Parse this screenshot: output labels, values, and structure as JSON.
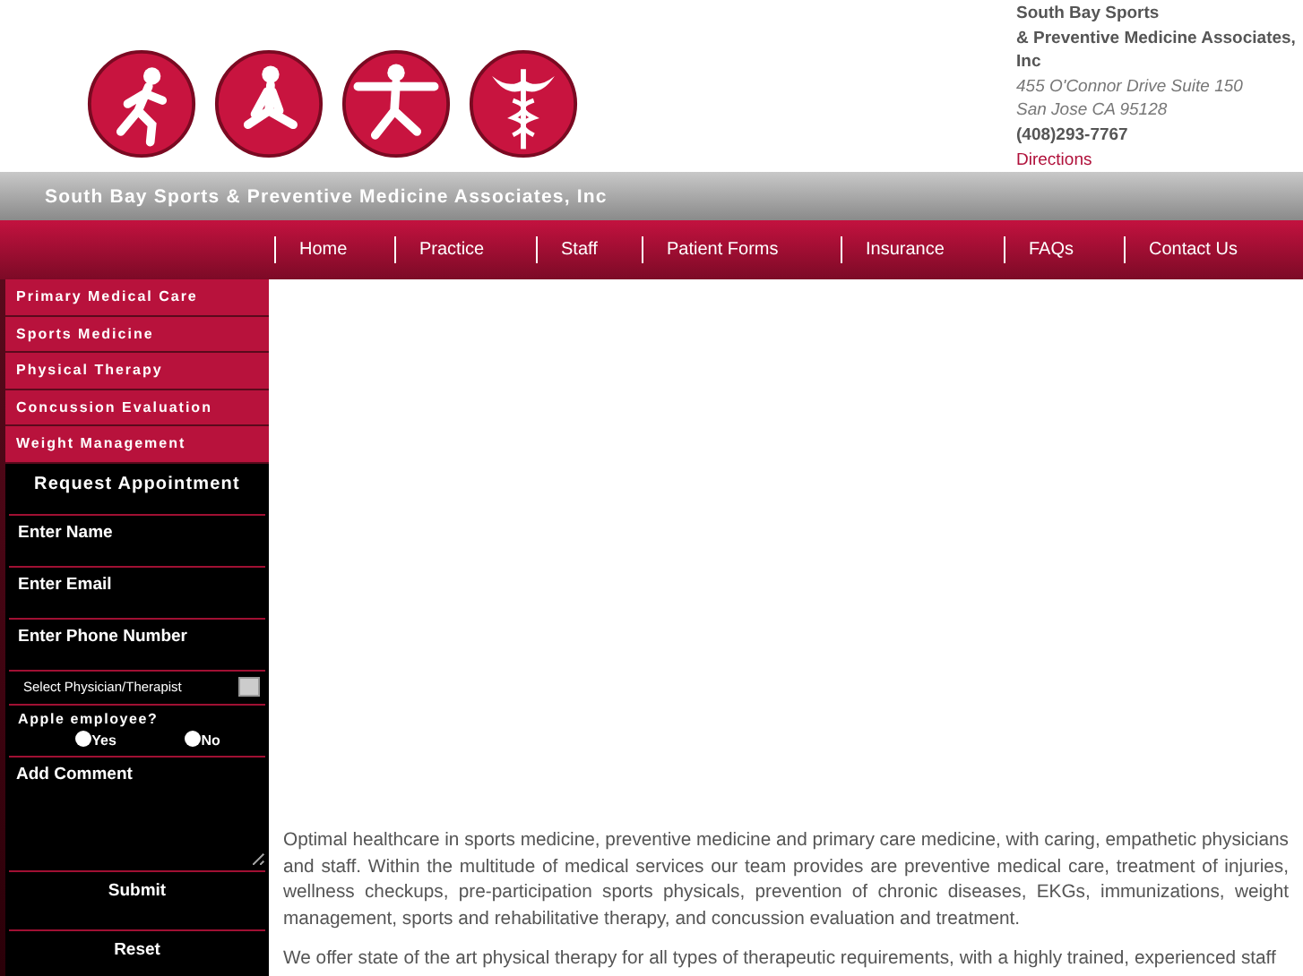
{
  "logo_icons": [
    {
      "kind": "runner"
    },
    {
      "kind": "sitting"
    },
    {
      "kind": "yoga"
    },
    {
      "kind": "caduceus"
    }
  ],
  "contact": {
    "name_lines": [
      "South Bay Sports",
      "& Preventive Medicine Associates,",
      "Inc"
    ],
    "address_lines": [
      "455 O'Connor Drive Suite 150",
      "San Jose CA 95128"
    ],
    "phone": "(408)293-7767",
    "directions_link": "Directions"
  },
  "banner_title": "South Bay Sports & Preventive Medicine Associates, Inc",
  "nav": [
    {
      "label": "Home"
    },
    {
      "label": "Practice"
    },
    {
      "label": "Staff"
    },
    {
      "label": "Patient Forms"
    },
    {
      "label": "Insurance"
    },
    {
      "label": "FAQs"
    },
    {
      "label": "Contact Us"
    }
  ],
  "sidebar": {
    "items": [
      "Primary Medical Care",
      "Sports Medicine",
      "Physical Therapy",
      "Concussion Evaluation",
      "Weight Management"
    ]
  },
  "appointment_form": {
    "title": "Request Appointment",
    "name_placeholder": "Enter Name",
    "email_placeholder": "Enter Email",
    "phone_placeholder": "Enter Phone Number",
    "physician_select": "Select Physician/Therapist",
    "apple_question": "Apple employee?",
    "apple_options": [
      {
        "label": "Yes",
        "selected": false
      },
      {
        "label": "No",
        "selected": false
      }
    ],
    "comment_placeholder": "Add Comment",
    "submit": "Submit",
    "reset": "Reset"
  },
  "content": {
    "paragraphs": [
      "Optimal healthcare in sports medicine, preventive medicine and primary care medicine, with caring, empathetic physicians and staff. Within the multitude of medical services our team provides are preventive medical care, treatment of injuries, wellness checkups, pre-participation sports physicals, prevention of chronic diseases, EKGs, immunizations, weight management, sports and rehabilitative therapy, and concussion evaluation and treatment.",
      "We offer state of the art physical therapy for all types of therapeutic requirements, with a highly trained, experienced staff"
    ]
  }
}
